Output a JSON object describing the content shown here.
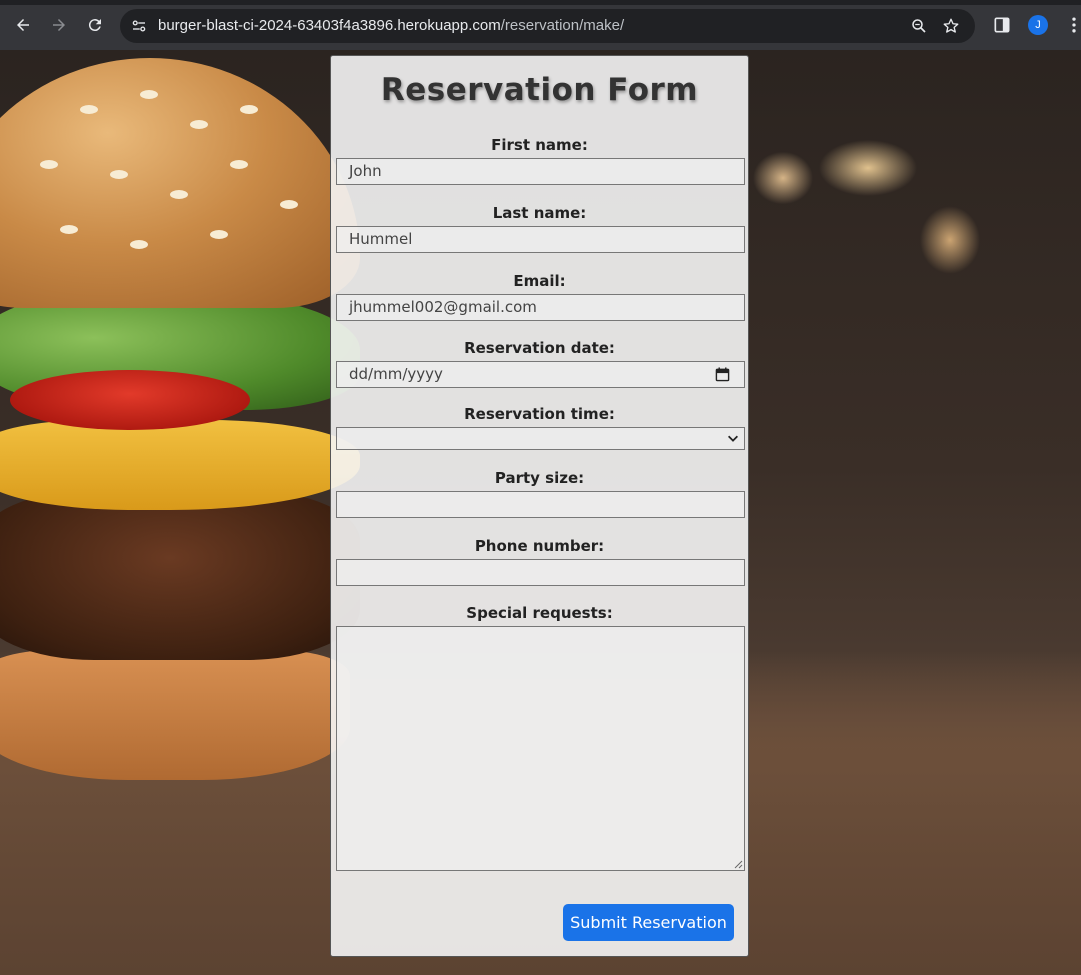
{
  "browser": {
    "url_host": "burger-blast-ci-2024-63403f4a3896.herokuapp.com",
    "url_path": "/reservation/make/",
    "avatar_letter": "J",
    "icons": [
      "back-icon",
      "forward-icon",
      "reload-icon",
      "site-info-icon",
      "zoom-icon",
      "bookmark-star-icon",
      "side-panel-icon",
      "avatar",
      "menu-kebab-icon"
    ]
  },
  "form": {
    "title": "Reservation Form",
    "fields": {
      "first_name": {
        "label": "First name:",
        "value": "John"
      },
      "last_name": {
        "label": "Last name:",
        "value": "Hummel"
      },
      "email": {
        "label": "Email:",
        "value": "jhummel002@gmail.com"
      },
      "date": {
        "label": "Reservation date:",
        "placeholder": "dd/mm/yyyy"
      },
      "time": {
        "label": "Reservation time:",
        "value": ""
      },
      "party_size": {
        "label": "Party size:",
        "value": ""
      },
      "phone": {
        "label": "Phone number:",
        "value": ""
      },
      "special_requests": {
        "label": "Special requests:",
        "value": ""
      }
    },
    "submit_label": "Submit Reservation"
  },
  "colors": {
    "accent": "#1a73e8",
    "chrome_bg": "#35363a"
  }
}
